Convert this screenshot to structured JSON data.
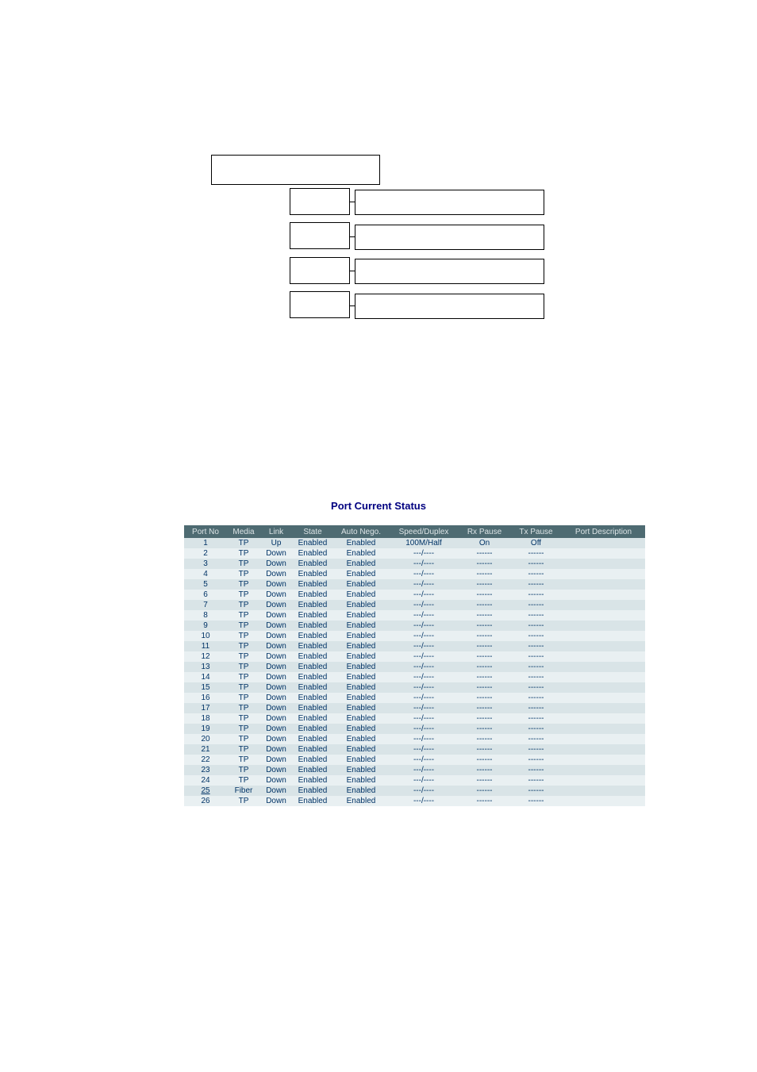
{
  "tree": {
    "root": "",
    "branches": [
      {
        "left": "",
        "right": ""
      },
      {
        "left": "",
        "right": ""
      },
      {
        "left": "",
        "right": ""
      },
      {
        "left": "",
        "right": ""
      }
    ]
  },
  "status": {
    "title": "Port Current Status",
    "headers": {
      "port_no": "Port No",
      "media": "Media",
      "link": "Link",
      "state": "State",
      "auto_nego": "Auto Nego.",
      "speed_duplex": "Speed/Duplex",
      "rx_pause": "Rx Pause",
      "tx_pause": "Tx Pause",
      "port_desc": "Port Description"
    },
    "dash6": "------",
    "speed_dash": "---/----",
    "rows": [
      {
        "port_no": "1",
        "media": "TP",
        "link": "Up",
        "state": "Enabled",
        "auto_nego": "Enabled",
        "speed_duplex": "100M/Half",
        "rx_pause": "On",
        "tx_pause": "Off",
        "port_desc": "",
        "link_down": false,
        "port_link": false
      },
      {
        "port_no": "2",
        "media": "TP",
        "link": "Down",
        "state": "Enabled",
        "auto_nego": "Enabled",
        "speed_duplex": "---/----",
        "rx_pause": "------",
        "tx_pause": "------",
        "port_desc": "",
        "link_down": true,
        "port_link": false
      },
      {
        "port_no": "3",
        "media": "TP",
        "link": "Down",
        "state": "Enabled",
        "auto_nego": "Enabled",
        "speed_duplex": "---/----",
        "rx_pause": "------",
        "tx_pause": "------",
        "port_desc": "",
        "link_down": true,
        "port_link": false
      },
      {
        "port_no": "4",
        "media": "TP",
        "link": "Down",
        "state": "Enabled",
        "auto_nego": "Enabled",
        "speed_duplex": "---/----",
        "rx_pause": "------",
        "tx_pause": "------",
        "port_desc": "",
        "link_down": true,
        "port_link": false
      },
      {
        "port_no": "5",
        "media": "TP",
        "link": "Down",
        "state": "Enabled",
        "auto_nego": "Enabled",
        "speed_duplex": "---/----",
        "rx_pause": "------",
        "tx_pause": "------",
        "port_desc": "",
        "link_down": true,
        "port_link": false
      },
      {
        "port_no": "6",
        "media": "TP",
        "link": "Down",
        "state": "Enabled",
        "auto_nego": "Enabled",
        "speed_duplex": "---/----",
        "rx_pause": "------",
        "tx_pause": "------",
        "port_desc": "",
        "link_down": true,
        "port_link": false
      },
      {
        "port_no": "7",
        "media": "TP",
        "link": "Down",
        "state": "Enabled",
        "auto_nego": "Enabled",
        "speed_duplex": "---/----",
        "rx_pause": "------",
        "tx_pause": "------",
        "port_desc": "",
        "link_down": true,
        "port_link": false
      },
      {
        "port_no": "8",
        "media": "TP",
        "link": "Down",
        "state": "Enabled",
        "auto_nego": "Enabled",
        "speed_duplex": "---/----",
        "rx_pause": "------",
        "tx_pause": "------",
        "port_desc": "",
        "link_down": true,
        "port_link": false
      },
      {
        "port_no": "9",
        "media": "TP",
        "link": "Down",
        "state": "Enabled",
        "auto_nego": "Enabled",
        "speed_duplex": "---/----",
        "rx_pause": "------",
        "tx_pause": "------",
        "port_desc": "",
        "link_down": true,
        "port_link": false
      },
      {
        "port_no": "10",
        "media": "TP",
        "link": "Down",
        "state": "Enabled",
        "auto_nego": "Enabled",
        "speed_duplex": "---/----",
        "rx_pause": "------",
        "tx_pause": "------",
        "port_desc": "",
        "link_down": true,
        "port_link": false
      },
      {
        "port_no": "11",
        "media": "TP",
        "link": "Down",
        "state": "Enabled",
        "auto_nego": "Enabled",
        "speed_duplex": "---/----",
        "rx_pause": "------",
        "tx_pause": "------",
        "port_desc": "",
        "link_down": true,
        "port_link": false
      },
      {
        "port_no": "12",
        "media": "TP",
        "link": "Down",
        "state": "Enabled",
        "auto_nego": "Enabled",
        "speed_duplex": "---/----",
        "rx_pause": "------",
        "tx_pause": "------",
        "port_desc": "",
        "link_down": true,
        "port_link": false
      },
      {
        "port_no": "13",
        "media": "TP",
        "link": "Down",
        "state": "Enabled",
        "auto_nego": "Enabled",
        "speed_duplex": "---/----",
        "rx_pause": "------",
        "tx_pause": "------",
        "port_desc": "",
        "link_down": true,
        "port_link": false
      },
      {
        "port_no": "14",
        "media": "TP",
        "link": "Down",
        "state": "Enabled",
        "auto_nego": "Enabled",
        "speed_duplex": "---/----",
        "rx_pause": "------",
        "tx_pause": "------",
        "port_desc": "",
        "link_down": true,
        "port_link": false
      },
      {
        "port_no": "15",
        "media": "TP",
        "link": "Down",
        "state": "Enabled",
        "auto_nego": "Enabled",
        "speed_duplex": "---/----",
        "rx_pause": "------",
        "tx_pause": "------",
        "port_desc": "",
        "link_down": true,
        "port_link": false
      },
      {
        "port_no": "16",
        "media": "TP",
        "link": "Down",
        "state": "Enabled",
        "auto_nego": "Enabled",
        "speed_duplex": "---/----",
        "rx_pause": "------",
        "tx_pause": "------",
        "port_desc": "",
        "link_down": true,
        "port_link": false
      },
      {
        "port_no": "17",
        "media": "TP",
        "link": "Down",
        "state": "Enabled",
        "auto_nego": "Enabled",
        "speed_duplex": "---/----",
        "rx_pause": "------",
        "tx_pause": "------",
        "port_desc": "",
        "link_down": true,
        "port_link": false
      },
      {
        "port_no": "18",
        "media": "TP",
        "link": "Down",
        "state": "Enabled",
        "auto_nego": "Enabled",
        "speed_duplex": "---/----",
        "rx_pause": "------",
        "tx_pause": "------",
        "port_desc": "",
        "link_down": true,
        "port_link": false
      },
      {
        "port_no": "19",
        "media": "TP",
        "link": "Down",
        "state": "Enabled",
        "auto_nego": "Enabled",
        "speed_duplex": "---/----",
        "rx_pause": "------",
        "tx_pause": "------",
        "port_desc": "",
        "link_down": true,
        "port_link": false
      },
      {
        "port_no": "20",
        "media": "TP",
        "link": "Down",
        "state": "Enabled",
        "auto_nego": "Enabled",
        "speed_duplex": "---/----",
        "rx_pause": "------",
        "tx_pause": "------",
        "port_desc": "",
        "link_down": true,
        "port_link": false
      },
      {
        "port_no": "21",
        "media": "TP",
        "link": "Down",
        "state": "Enabled",
        "auto_nego": "Enabled",
        "speed_duplex": "---/----",
        "rx_pause": "------",
        "tx_pause": "------",
        "port_desc": "",
        "link_down": true,
        "port_link": false
      },
      {
        "port_no": "22",
        "media": "TP",
        "link": "Down",
        "state": "Enabled",
        "auto_nego": "Enabled",
        "speed_duplex": "---/----",
        "rx_pause": "------",
        "tx_pause": "------",
        "port_desc": "",
        "link_down": true,
        "port_link": false
      },
      {
        "port_no": "23",
        "media": "TP",
        "link": "Down",
        "state": "Enabled",
        "auto_nego": "Enabled",
        "speed_duplex": "---/----",
        "rx_pause": "------",
        "tx_pause": "------",
        "port_desc": "",
        "link_down": true,
        "port_link": false
      },
      {
        "port_no": "24",
        "media": "TP",
        "link": "Down",
        "state": "Enabled",
        "auto_nego": "Enabled",
        "speed_duplex": "---/----",
        "rx_pause": "------",
        "tx_pause": "------",
        "port_desc": "",
        "link_down": true,
        "port_link": false
      },
      {
        "port_no": "25",
        "media": "Fiber",
        "link": "Down",
        "state": "Enabled",
        "auto_nego": "Enabled",
        "speed_duplex": "---/----",
        "rx_pause": "------",
        "tx_pause": "------",
        "port_desc": "",
        "link_down": true,
        "port_link": true
      },
      {
        "port_no": "26",
        "media": "TP",
        "link": "Down",
        "state": "Enabled",
        "auto_nego": "Enabled",
        "speed_duplex": "---/----",
        "rx_pause": "------",
        "tx_pause": "------",
        "port_desc": "",
        "link_down": true,
        "port_link": false
      }
    ]
  }
}
